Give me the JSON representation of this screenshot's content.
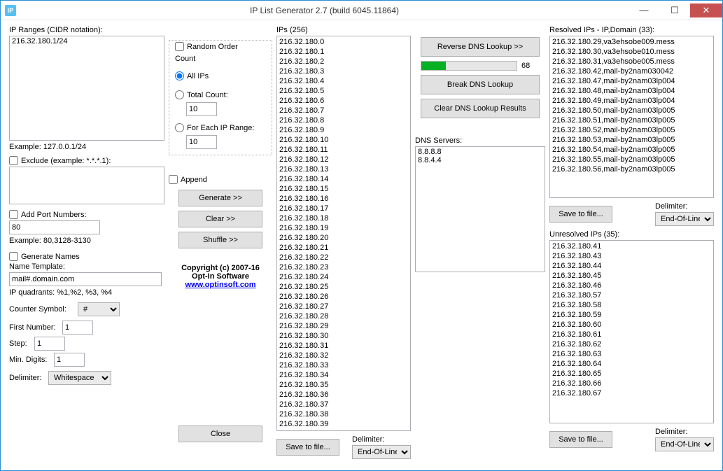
{
  "titlebar": {
    "title": "IP List Generator 2.7 (build 6045.11864)",
    "icon": "IP"
  },
  "labels": {
    "ip_ranges": "IP Ranges (CIDR notation):",
    "example_cidr": "Example: 127.0.0.1/24",
    "exclude": "Exclude (example: *.*.*.1):",
    "add_port": "Add Port Numbers:",
    "example_port": "Example: 80,3128-3130",
    "generate_names": "Generate Names",
    "name_template": "Name Template:",
    "ip_quadrants": "IP quadrants: %1,%2, %3, %4",
    "counter_symbol": "Counter Symbol:",
    "first_number": "First Number:",
    "step": "Step:",
    "min_digits": "Min. Digits:",
    "delimiter": "Delimiter:",
    "random_order": "Random Order",
    "count": "Count",
    "all_ips": "All IPs",
    "total_count": "Total Count:",
    "for_each_range": "For Each IP Range:",
    "append": "Append",
    "generate": "Generate >>",
    "clear": "Clear >>",
    "shuffle": "Shuffle >>",
    "close": "Close",
    "save_to_file": "Save to file...",
    "ips": "IPs (256)",
    "reverse_dns": "Reverse DNS Lookup >>",
    "break_dns": "Break DNS Lookup",
    "clear_dns": "Clear DNS Lookup Results",
    "dns_servers": "DNS Servers:",
    "resolved_ips": "Resolved IPs - IP,Domain (33):",
    "unresolved_ips": "Unresolved IPs (35):",
    "copyright1": "Copyright (c) 2007-16",
    "copyright2": "Opt-In Software",
    "website": "www.optinsoft.com"
  },
  "values": {
    "ip_ranges_text": "216.32.180.1/24",
    "port": "80",
    "name_template": "mail#.domain.com",
    "counter_symbol": "#",
    "first_number": "1",
    "step": "1",
    "min_digits": "1",
    "delimiter1": "Whitespace",
    "total_count": "10",
    "for_each": "10",
    "progress_value": "68",
    "delimiter_eol": "End-Of-Line"
  },
  "ips_list": [
    "216.32.180.0",
    "216.32.180.1",
    "216.32.180.2",
    "216.32.180.3",
    "216.32.180.4",
    "216.32.180.5",
    "216.32.180.6",
    "216.32.180.7",
    "216.32.180.8",
    "216.32.180.9",
    "216.32.180.10",
    "216.32.180.11",
    "216.32.180.12",
    "216.32.180.13",
    "216.32.180.14",
    "216.32.180.15",
    "216.32.180.16",
    "216.32.180.17",
    "216.32.180.18",
    "216.32.180.19",
    "216.32.180.20",
    "216.32.180.21",
    "216.32.180.22",
    "216.32.180.23",
    "216.32.180.24",
    "216.32.180.25",
    "216.32.180.26",
    "216.32.180.27",
    "216.32.180.28",
    "216.32.180.29",
    "216.32.180.30",
    "216.32.180.31",
    "216.32.180.32",
    "216.32.180.33",
    "216.32.180.34",
    "216.32.180.35",
    "216.32.180.36",
    "216.32.180.37",
    "216.32.180.38",
    "216.32.180.39"
  ],
  "dns_servers": [
    "8.8.8.8",
    "8.8.4.4"
  ],
  "resolved_list": [
    "216.32.180.29,va3ehsobe009.mess",
    "216.32.180.30,va3ehsobe010.mess",
    "216.32.180.31,va3ehsobe005.mess",
    "216.32.180.42,mail-by2nam030042",
    "216.32.180.47,mail-by2nam03lp004",
    "216.32.180.48,mail-by2nam03lp004",
    "216.32.180.49,mail-by2nam03lp004",
    "216.32.180.50,mail-by2nam03lp005",
    "216.32.180.51,mail-by2nam03lp005",
    "216.32.180.52,mail-by2nam03lp005",
    "216.32.180.53,mail-by2nam03lp005",
    "216.32.180.54,mail-by2nam03lp005",
    "216.32.180.55,mail-by2nam03lp005",
    "216.32.180.56,mail-by2nam03lp005"
  ],
  "unresolved_list": [
    "216.32.180.41",
    "216.32.180.43",
    "216.32.180.44",
    "216.32.180.45",
    "216.32.180.46",
    "216.32.180.57",
    "216.32.180.58",
    "216.32.180.59",
    "216.32.180.60",
    "216.32.180.61",
    "216.32.180.62",
    "216.32.180.63",
    "216.32.180.64",
    "216.32.180.65",
    "216.32.180.66",
    "216.32.180.67"
  ]
}
